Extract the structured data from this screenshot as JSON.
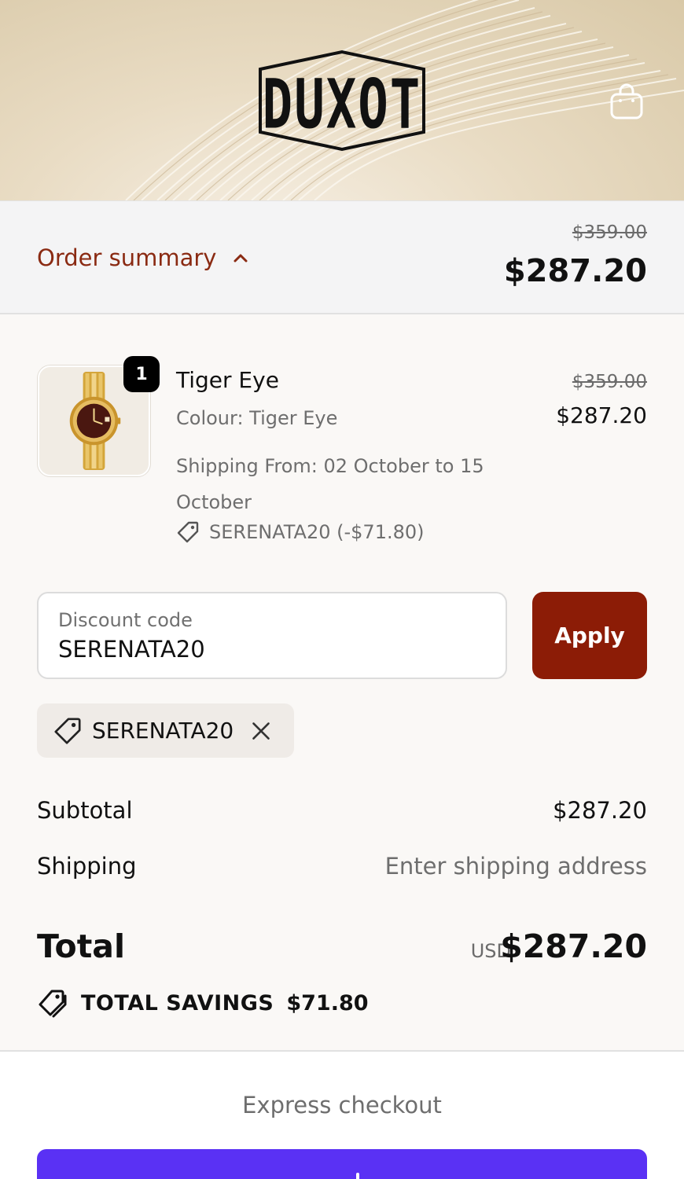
{
  "header": {
    "logo_text": "DUXOT",
    "cart_icon": "shopping-bag-icon"
  },
  "order_summary": {
    "label": "Order summary",
    "toggle_icon": "chevron-up-icon",
    "original_price": "$359.00",
    "price": "$287.20"
  },
  "line_item": {
    "quantity": "1",
    "name": "Tiger Eye",
    "colour": "Colour: Tiger Eye",
    "shipping": "Shipping From: 02 October to 15 October",
    "discount": "SERENATA20 (-$71.80)",
    "original_price": "$359.00",
    "price": "$287.20",
    "image": "gold-watch"
  },
  "discount_form": {
    "label": "Discount code",
    "value": "SERENATA20",
    "apply_label": "Apply"
  },
  "applied_code": {
    "code": "SERENATA20",
    "tag_icon": "tag-icon",
    "remove_icon": "close-icon"
  },
  "totals": {
    "subtotal_label": "Subtotal",
    "subtotal_value": "$287.20",
    "shipping_label": "Shipping",
    "shipping_value": "Enter shipping address",
    "total_label": "Total",
    "currency": "USD",
    "total_value": "$287.20",
    "savings_label": "TOTAL SAVINGS",
    "savings_value": "$71.80"
  },
  "express": {
    "label": "Express checkout"
  },
  "colors": {
    "accent": "#8c1c06",
    "summary_label": "#8a2a12",
    "express_button": "#5a31f4"
  }
}
